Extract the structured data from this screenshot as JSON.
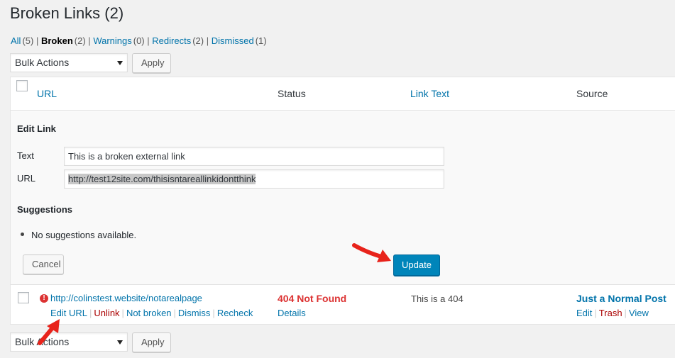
{
  "page": {
    "title": "Broken Links (2)"
  },
  "filters": [
    {
      "label": "All",
      "count": "(5)",
      "current": false
    },
    {
      "label": "Broken",
      "count": "(2)",
      "current": true
    },
    {
      "label": "Warnings",
      "count": "(0)",
      "current": false
    },
    {
      "label": "Redirects",
      "count": "(2)",
      "current": false
    },
    {
      "label": "Dismissed",
      "count": "(1)",
      "current": false
    }
  ],
  "bulk_top": {
    "selected": "Bulk Actions",
    "apply_label": "Apply"
  },
  "bulk_bottom": {
    "selected": "Bulk Actions",
    "apply_label": "Apply"
  },
  "columns": {
    "url": "URL",
    "status": "Status",
    "link_text": "Link Text",
    "source": "Source"
  },
  "edit_link": {
    "heading": "Edit Link",
    "text_label": "Text",
    "text_value": "This is a broken external link",
    "url_label": "URL",
    "url_value": "http://test12site.com/thisisntareallinkidontthink",
    "suggestions_heading": "Suggestions",
    "suggestion_item": "No suggestions available.",
    "cancel_label": "Cancel",
    "update_label": "Update"
  },
  "row": {
    "url": "http://colinstest.website/notarealpage",
    "actions": [
      "Edit URL",
      "Unlink",
      "Not broken",
      "Dismiss",
      "Recheck"
    ],
    "status": "404 Not Found",
    "details_label": "Details",
    "link_text": "This is a 404",
    "source_title": "Just a Normal Post",
    "source_actions": [
      "Edit",
      "Trash",
      "View"
    ]
  },
  "colors": {
    "accent": "#0073aa",
    "primary_button": "#0085ba",
    "error": "#dc3232",
    "arrow": "#e8231b"
  }
}
